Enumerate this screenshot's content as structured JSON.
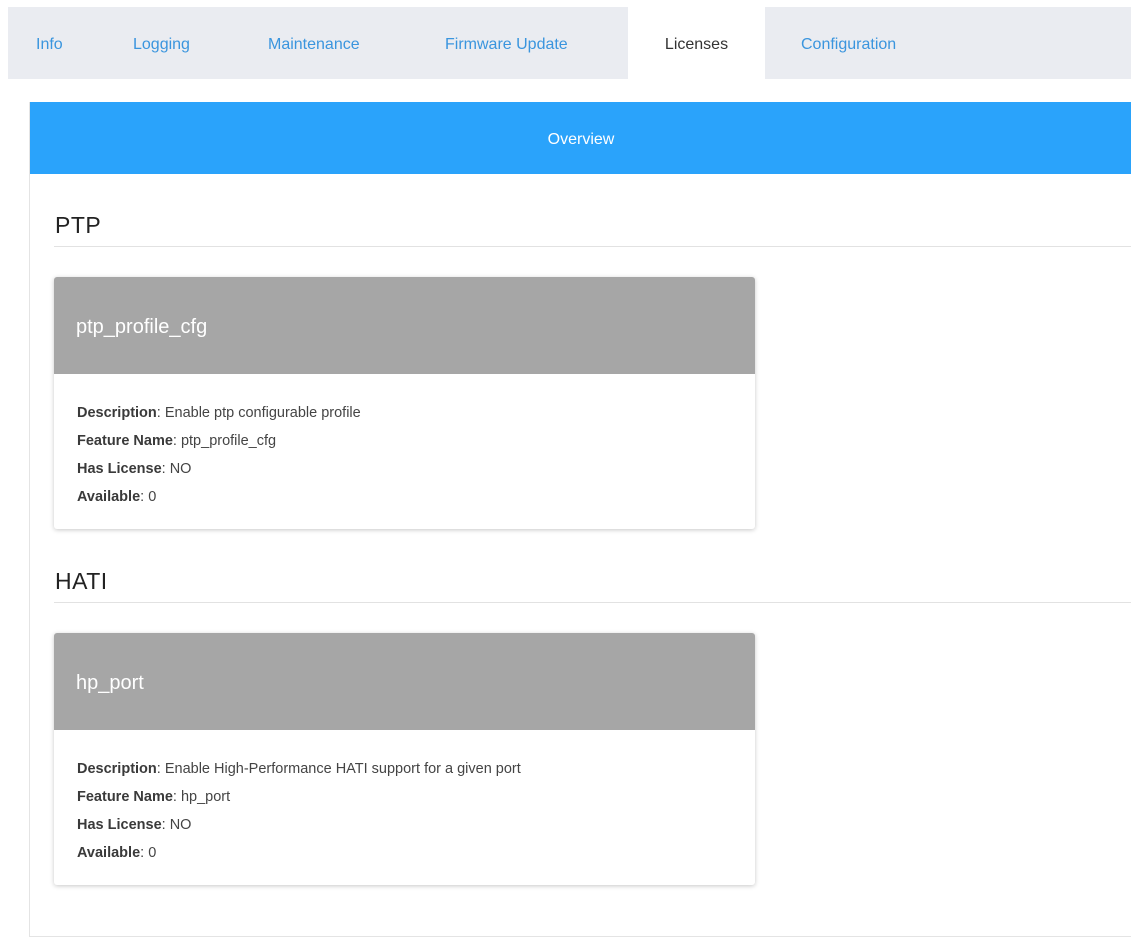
{
  "tabs": [
    {
      "label": "Info",
      "active": false
    },
    {
      "label": "Logging",
      "active": false
    },
    {
      "label": "Maintenance",
      "active": false
    },
    {
      "label": "Firmware Update",
      "active": false
    },
    {
      "label": "Licenses",
      "active": true
    },
    {
      "label": "Configuration",
      "active": false
    }
  ],
  "overview_label": "Overview",
  "field_labels": {
    "description": "Description",
    "feature_name": "Feature Name",
    "has_license": "Has License",
    "available": "Available",
    "separator": ": "
  },
  "sections": [
    {
      "title": "PTP",
      "card": {
        "header": "ptp_profile_cfg",
        "description": "Enable ptp configurable profile",
        "feature_name": "ptp_profile_cfg",
        "has_license": "NO",
        "available": "0"
      }
    },
    {
      "title": "HATI",
      "card": {
        "header": "hp_port",
        "description": "Enable High-Performance HATI support for a given port",
        "feature_name": "hp_port",
        "has_license": "NO",
        "available": "0"
      }
    }
  ],
  "colors": {
    "tab_link": "#3a95de",
    "tab_bar_bg": "#eaecf1",
    "overview_bg": "#2aa3fb",
    "card_header_bg": "#a6a6a6"
  }
}
